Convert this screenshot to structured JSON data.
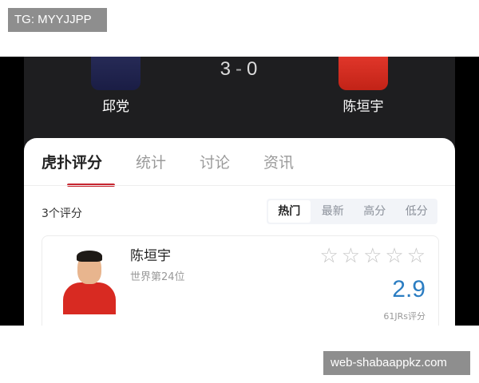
{
  "tg_label": "TG: MYYJJPP",
  "match": {
    "score_left": "3",
    "score_sep": "-",
    "score_right": "0",
    "player_left": "邱党",
    "player_right": "陈垣宇"
  },
  "tabs": [
    {
      "label": "虎扑评分",
      "active": true
    },
    {
      "label": "统计"
    },
    {
      "label": "讨论"
    },
    {
      "label": "资讯"
    }
  ],
  "ratings": {
    "count_label": "3个评分",
    "sort_options": [
      "热门",
      "最新",
      "高分",
      "低分"
    ],
    "active_sort": "热门"
  },
  "rating_card": {
    "name": "陈垣宇",
    "rank": "世界第24位",
    "stars": [
      "☆",
      "☆",
      "☆",
      "☆",
      "☆"
    ],
    "score": "2.9",
    "votes": "61JRs评分",
    "score_color": "#2b7dc2"
  },
  "watermark": "web-shabaappkz.com",
  "colors": {
    "accent": "#c7252f",
    "header_bg": "#1e1e20"
  }
}
